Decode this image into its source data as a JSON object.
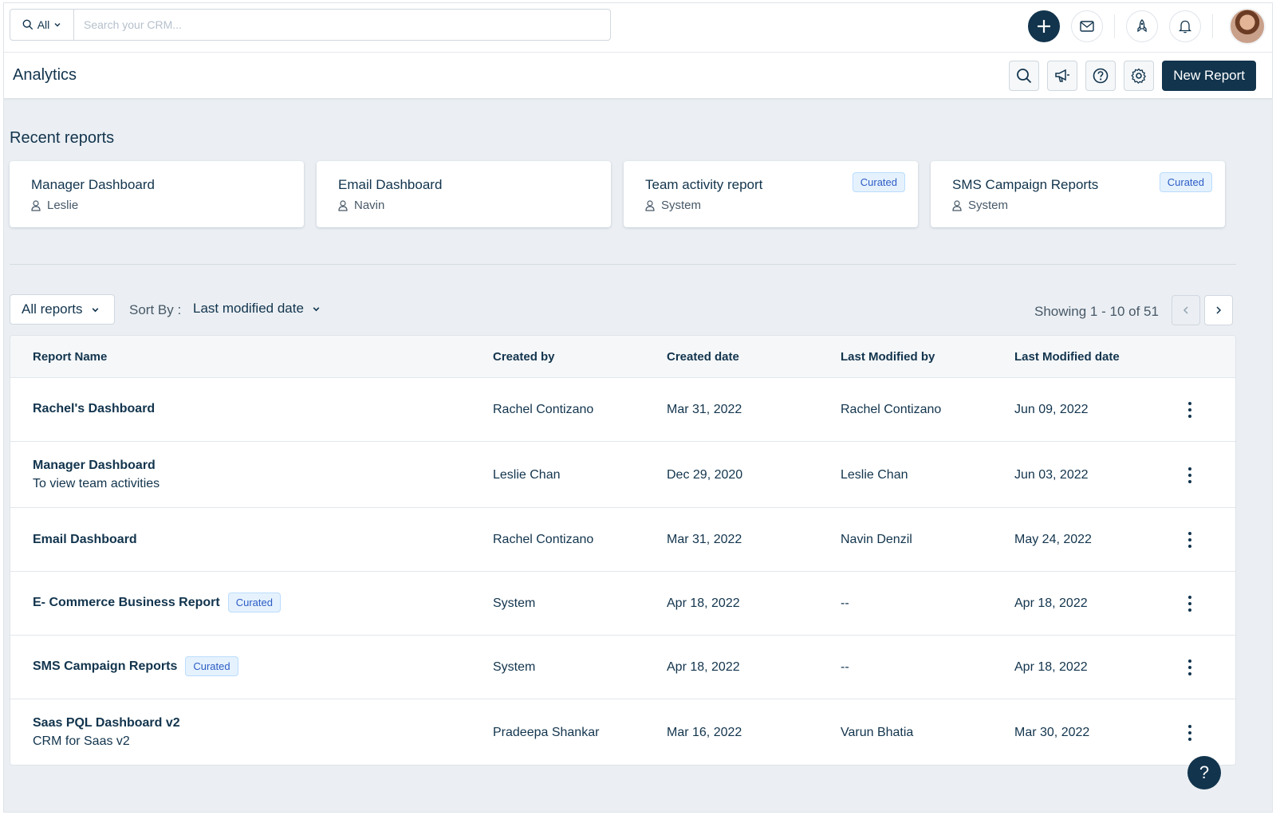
{
  "topbar": {
    "search_scope": "All",
    "search_placeholder": "Search your CRM..."
  },
  "header": {
    "title": "Analytics",
    "new_report_label": "New Report"
  },
  "recent": {
    "title": "Recent reports",
    "cards": [
      {
        "title": "Manager Dashboard",
        "owner": "Leslie",
        "badge": ""
      },
      {
        "title": "Email Dashboard",
        "owner": "Navin",
        "badge": ""
      },
      {
        "title": "Team activity report",
        "owner": "System",
        "badge": "Curated"
      },
      {
        "title": "SMS Campaign Reports",
        "owner": "System",
        "badge": "Curated"
      }
    ]
  },
  "filters": {
    "view_label": "All reports",
    "sort_label": "Sort By :",
    "sort_value": "Last modified date",
    "showing": "Showing 1 - 10 of 51"
  },
  "table": {
    "columns": [
      "Report Name",
      "Created by",
      "Created date",
      "Last Modified by",
      "Last Modified date"
    ],
    "rows": [
      {
        "name": "Rachel's Dashboard",
        "desc": "",
        "badge": "",
        "created_by": "Rachel Contizano",
        "created_date": "Mar 31, 2022",
        "modified_by": "Rachel Contizano",
        "modified_date": "Jun 09, 2022"
      },
      {
        "name": "Manager Dashboard",
        "desc": "To view team activities",
        "badge": "",
        "created_by": "Leslie Chan",
        "created_date": "Dec 29, 2020",
        "modified_by": "Leslie Chan",
        "modified_date": "Jun 03, 2022"
      },
      {
        "name": "Email Dashboard",
        "desc": "",
        "badge": "",
        "created_by": "Rachel Contizano",
        "created_date": "Mar 31, 2022",
        "modified_by": "Navin Denzil",
        "modified_date": "May 24, 2022"
      },
      {
        "name": "E- Commerce Business Report",
        "desc": "",
        "badge": "Curated",
        "created_by": "System",
        "created_date": "Apr 18, 2022",
        "modified_by": "--",
        "modified_date": "Apr 18, 2022"
      },
      {
        "name": "SMS Campaign Reports",
        "desc": "",
        "badge": "Curated",
        "created_by": "System",
        "created_date": "Apr 18, 2022",
        "modified_by": "--",
        "modified_date": "Apr 18, 2022"
      },
      {
        "name": "Saas PQL Dashboard v2",
        "desc": "CRM for Saas v2",
        "badge": "",
        "created_by": "Pradeepa Shankar",
        "created_date": "Mar 16, 2022",
        "modified_by": "Varun Bhatia",
        "modified_date": "Mar 30, 2022"
      }
    ]
  },
  "help_label": "?",
  "icons": {
    "add": "plus-icon",
    "mail": "mail-icon",
    "rocket": "rocket-icon",
    "bell": "bell-icon",
    "search": "search-icon",
    "announce": "megaphone-icon",
    "help": "question-icon",
    "settings": "gear-icon"
  },
  "colors": {
    "primary": "#12344d",
    "badge_text": "#2c5cc5",
    "badge_bg": "#e5f2fd",
    "page_bg": "#ebeff3"
  }
}
